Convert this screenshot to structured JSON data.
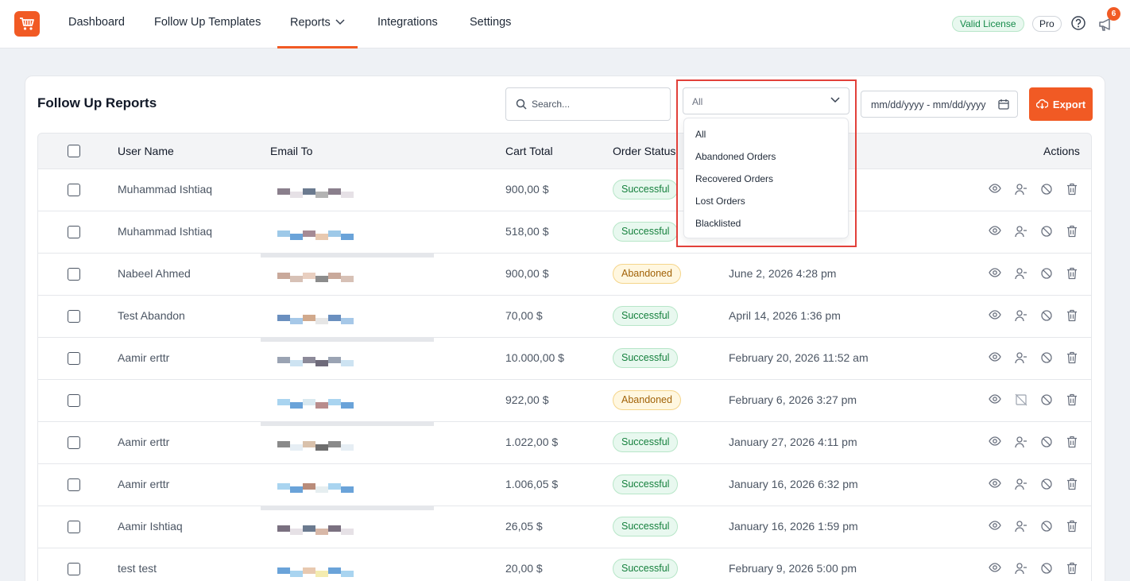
{
  "nav": {
    "items": [
      {
        "label": "Dashboard"
      },
      {
        "label": "Follow Up Templates"
      },
      {
        "label": "Reports"
      },
      {
        "label": "Integrations"
      },
      {
        "label": "Settings"
      }
    ],
    "license_label": "Valid License",
    "plan_label": "Pro",
    "notification_count": "6"
  },
  "toolbar": {
    "title": "Follow Up Reports",
    "search_placeholder": "Search...",
    "filter_value": "All",
    "date_placeholder": "mm/dd/yyyy - mm/dd/yyyy",
    "export_label": "Export"
  },
  "filter_menu": {
    "options": [
      "All",
      "Abandoned Orders",
      "Recovered Orders",
      "Lost Orders",
      "Blacklisted"
    ]
  },
  "table": {
    "headers": {
      "user_name": "User Name",
      "email_to": "Email To",
      "cart_total": "Cart Total",
      "order_status": "Order Status",
      "actions": "Actions"
    },
    "rows": [
      {
        "user": "Muhammad Ishtiaq",
        "total": "900,00 $",
        "status": "Successful",
        "date": ""
      },
      {
        "user": "Muhammad Ishtiaq",
        "total": "518,00 $",
        "status": "Successful",
        "date": ""
      },
      {
        "user": "Nabeel Ahmed",
        "total": "900,00 $",
        "status": "Abandoned",
        "date": "June 2, 2026 4:28 pm"
      },
      {
        "user": "Test Abandon",
        "total": "70,00 $",
        "status": "Successful",
        "date": "April 14, 2026 1:36 pm"
      },
      {
        "user": "Aamir erttr",
        "total": "10.000,00 $",
        "status": "Successful",
        "date": "February 20, 2026 11:52 am"
      },
      {
        "user": "",
        "total": "922,00 $",
        "status": "Abandoned",
        "date": "February 6, 2026 3:27 pm"
      },
      {
        "user": "Aamir erttr",
        "total": "1.022,00 $",
        "status": "Successful",
        "date": "January 27, 2026 4:11 pm"
      },
      {
        "user": "Aamir erttr",
        "total": "1.006,05 $",
        "status": "Successful",
        "date": "January 16, 2026 6:32 pm"
      },
      {
        "user": "Aamir Ishtiaq",
        "total": "26,05 $",
        "status": "Successful",
        "date": "January 16, 2026 1:59 pm"
      },
      {
        "user": "test test",
        "total": "20,00 $",
        "status": "Successful",
        "date": "February 9, 2026 5:00 pm"
      }
    ]
  },
  "colors": {
    "accent": "#f15a24",
    "success": "#15803d",
    "abandoned": "#a16207",
    "highlight": "#e2403a"
  },
  "icons": [
    "cart-logo-icon",
    "chevron-down-icon",
    "help-icon",
    "megaphone-icon",
    "search-icon",
    "calendar-icon",
    "cloud-download-icon",
    "eye-icon",
    "user-minus-icon",
    "block-icon",
    "trash-icon",
    "no-image-icon"
  ]
}
